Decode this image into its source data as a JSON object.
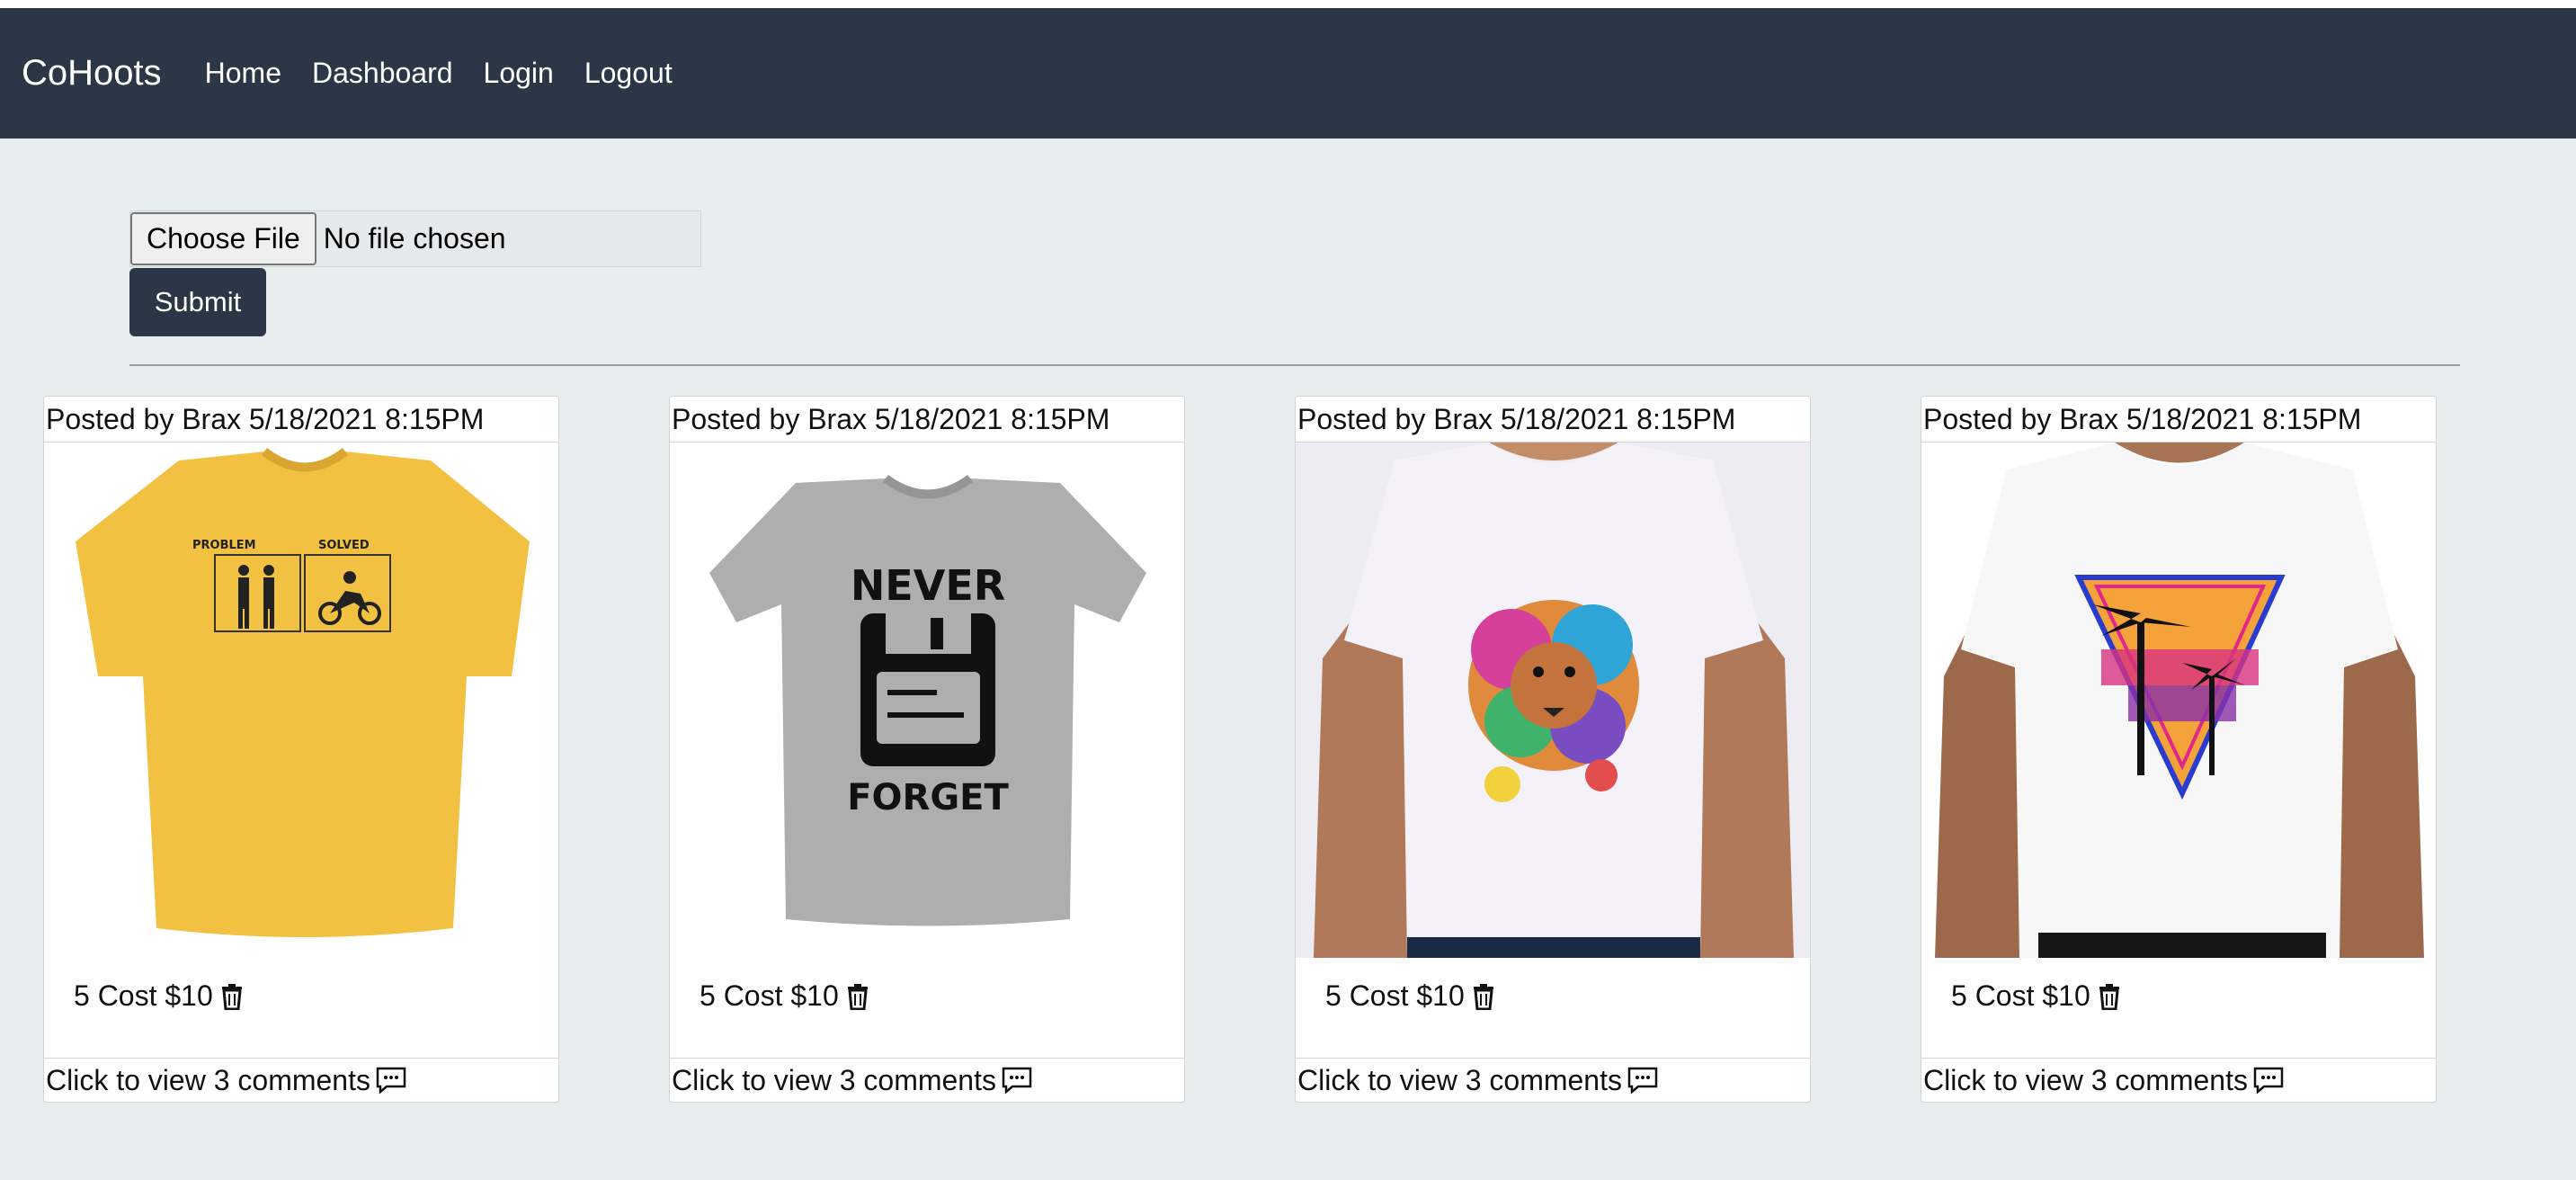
{
  "nav": {
    "brand": "CoHoots",
    "links": [
      "Home",
      "Dashboard",
      "Login",
      "Logout"
    ]
  },
  "upload": {
    "choose_label": "Choose File",
    "file_status": "No file chosen",
    "submit_label": "Submit"
  },
  "posts": [
    {
      "header": "Posted by Brax 5/18/2021 8:15PM",
      "cost": "5 Cost $10",
      "comments": "Click to view 3 comments"
    },
    {
      "header": "Posted by Brax 5/18/2021 8:15PM",
      "cost": "5 Cost $10",
      "comments": "Click to view 3 comments"
    },
    {
      "header": "Posted by Brax 5/18/2021 8:15PM",
      "cost": "5 Cost $10",
      "comments": "Click to view 3 comments"
    },
    {
      "header": "Posted by Brax 5/18/2021 8:15PM",
      "cost": "5 Cost $10",
      "comments": "Click to view 3 comments"
    }
  ],
  "shirt_images": [
    {
      "text_top": "PROBLEM",
      "text_top2": "SOLVED"
    },
    {
      "text_top": "NEVER",
      "text_bottom": "FORGET"
    },
    {},
    {}
  ],
  "icons": {
    "delete": "trash-icon",
    "comments": "chat-bubble-icon"
  },
  "colors": {
    "navbar": "#2b3647",
    "background": "#e8eeee",
    "submit": "#2b3647"
  }
}
